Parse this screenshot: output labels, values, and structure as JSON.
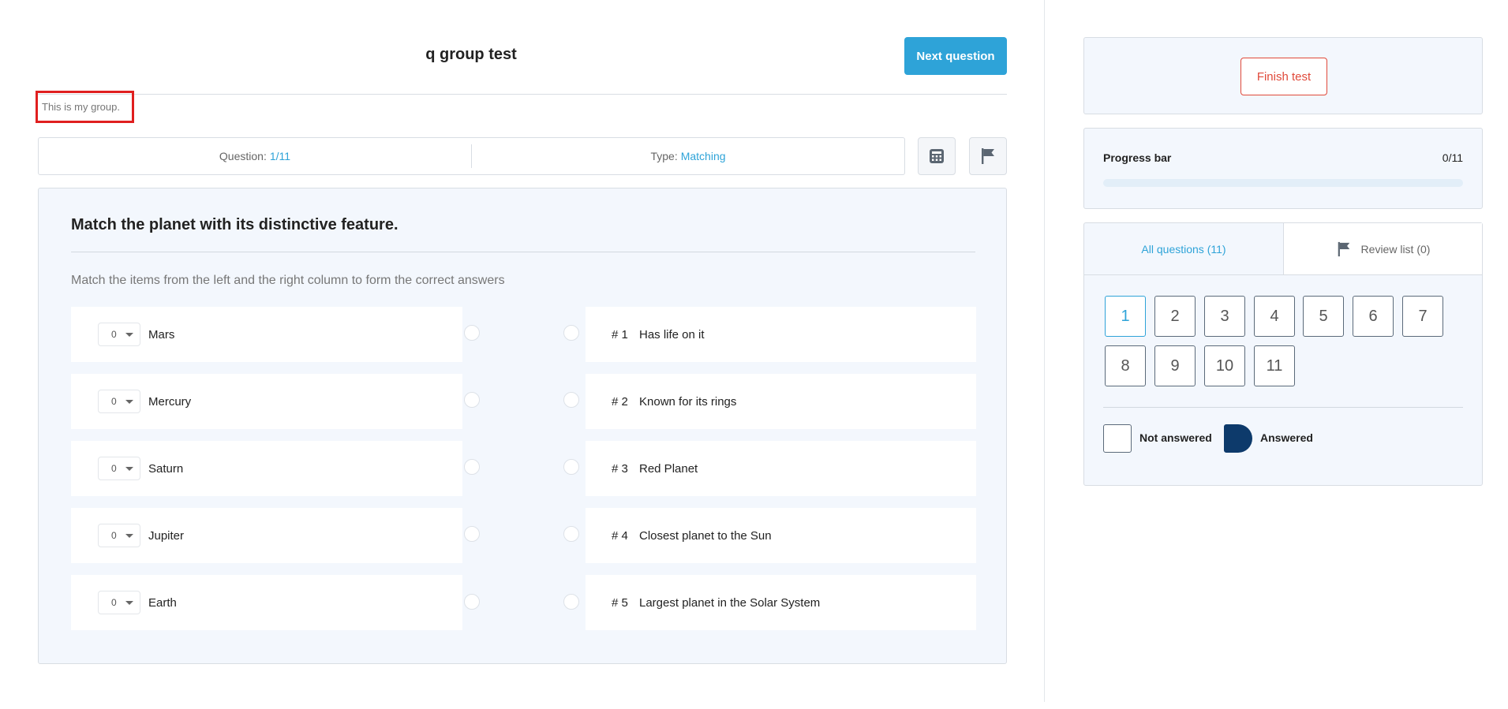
{
  "header": {
    "title": "q group test",
    "next_label": "Next question"
  },
  "group": {
    "description": "This is my group."
  },
  "info": {
    "question_label": "Question:",
    "question_value": "1/11",
    "type_label": "Type:",
    "type_value": "Matching"
  },
  "toolbar": {
    "calculator_icon": "calculator-icon",
    "flag_icon": "flag-icon"
  },
  "question": {
    "title": "Match the planet with its distinctive feature.",
    "instruction": "Match the items from the left and the right column to form the correct answers",
    "left_items": [
      {
        "select": "0",
        "text": "Mars"
      },
      {
        "select": "0",
        "text": "Mercury"
      },
      {
        "select": "0",
        "text": "Saturn"
      },
      {
        "select": "0",
        "text": "Jupiter"
      },
      {
        "select": "0",
        "text": "Earth"
      }
    ],
    "right_items": [
      {
        "num": "# 1",
        "text": "Has life on it"
      },
      {
        "num": "# 2",
        "text": "Known for its rings"
      },
      {
        "num": "# 3",
        "text": "Red Planet"
      },
      {
        "num": "# 4",
        "text": "Closest planet to the Sun"
      },
      {
        "num": "# 5",
        "text": "Largest planet in the Solar System"
      }
    ]
  },
  "sidebar": {
    "finish_label": "Finish test",
    "progress_label": "Progress bar",
    "progress_count": "0/11",
    "progress_fraction": 0,
    "tab_all": "All questions (11)",
    "tab_review": "Review list (0)",
    "questions": [
      "1",
      "2",
      "3",
      "4",
      "5",
      "6",
      "7",
      "8",
      "9",
      "10",
      "11"
    ],
    "current_question": "1",
    "legend_not": "Not answered",
    "legend_yes": "Answered"
  },
  "colors": {
    "accent": "#2ea3d8",
    "danger": "#e0493a",
    "answered": "#0d3a6b",
    "highlight": "#e01f1f"
  }
}
